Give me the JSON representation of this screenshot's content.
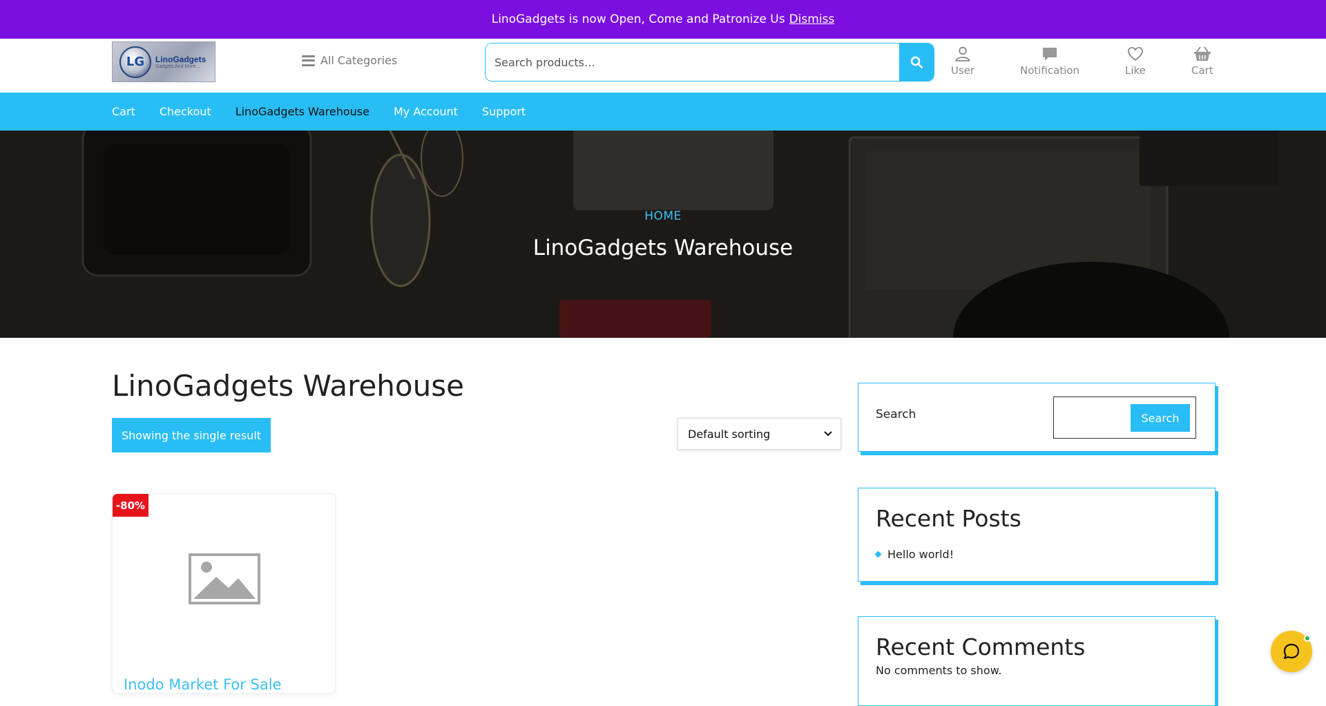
{
  "notice": {
    "text": "LinoGadgets is now Open, Come and Patronize Us",
    "dismiss": "Dismiss"
  },
  "header": {
    "logo": {
      "mark": "LG",
      "name": "LinoGadgets",
      "tagline": "Gadgets And More..."
    },
    "categories_label": "All Categories",
    "search_placeholder": "Search products…",
    "icons": [
      {
        "label": "User",
        "icon": "user-icon"
      },
      {
        "label": "Notification",
        "icon": "notification-icon"
      },
      {
        "label": "Like",
        "icon": "heart-icon"
      },
      {
        "label": "Cart",
        "icon": "basket-icon"
      }
    ]
  },
  "nav": [
    {
      "label": "Cart"
    },
    {
      "label": "Checkout"
    },
    {
      "label": "LinoGadgets Warehouse",
      "active": true
    },
    {
      "label": "My Account"
    },
    {
      "label": "Support"
    }
  ],
  "hero": {
    "breadcrumb": "HOME",
    "title": "LinoGadgets Warehouse"
  },
  "main": {
    "title": "LinoGadgets Warehouse",
    "result_count": "Showing the single result",
    "sort_selected": "Default sorting"
  },
  "product": {
    "sale_badge": "-80%",
    "title": "Inodo Market For Sale"
  },
  "sidebar": {
    "search": {
      "label": "Search",
      "button": "Search"
    },
    "recent_posts": {
      "title": "Recent Posts",
      "items": [
        "Hello world!"
      ]
    },
    "recent_comments": {
      "title": "Recent Comments",
      "empty": "No comments to show."
    }
  },
  "colors": {
    "notice_bg": "#7b0fe0",
    "accent": "#29bdf5",
    "sale": "#e8141c",
    "chat": "#f6c31e"
  }
}
